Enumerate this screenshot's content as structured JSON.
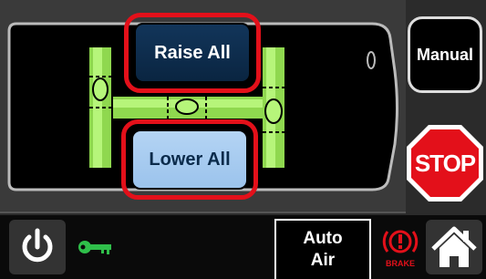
{
  "controls": {
    "raise_all_label": "Raise All",
    "lower_all_label": "Lower All",
    "manual_label": "Manual",
    "stop_label": "STOP"
  },
  "bottom_bar": {
    "auto_air_line1": "Auto",
    "auto_air_line2": "Air",
    "brake_label": "BRAKE"
  },
  "icons": {
    "power": "power-icon",
    "key": "key-icon",
    "brake": "brake-warning-icon",
    "home": "home-icon"
  },
  "colors": {
    "highlight_red": "#e3101a",
    "stop_red": "#e3101a",
    "level_green": "#9ef05a",
    "raise_button": "#12355a",
    "lower_button": "#a9cdf2"
  }
}
